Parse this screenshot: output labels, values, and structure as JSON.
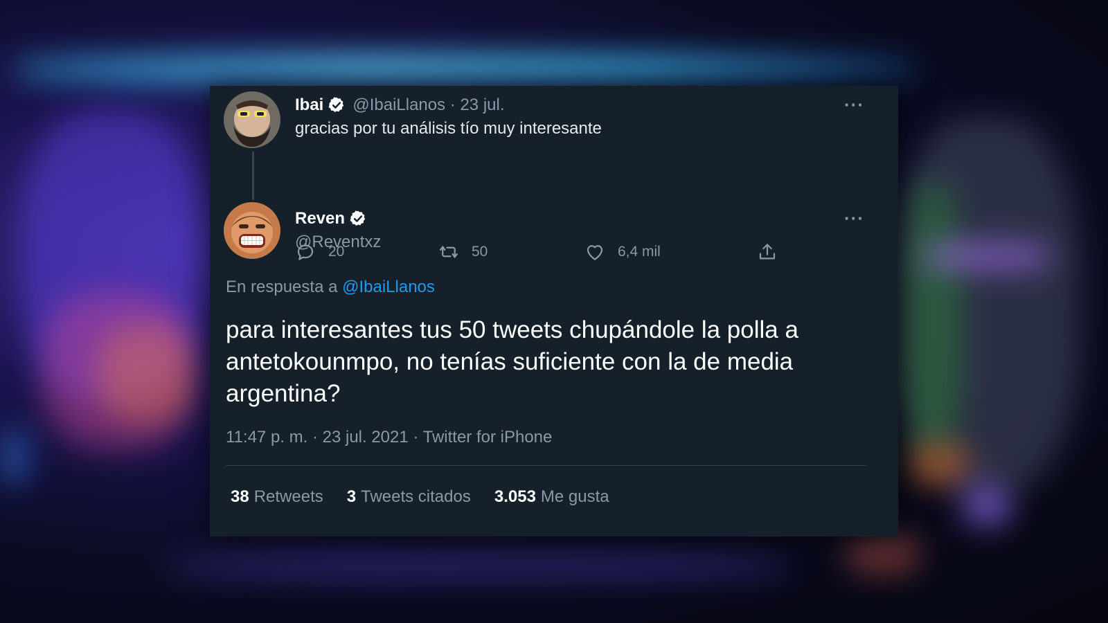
{
  "parent_tweet": {
    "author_name": "Ibai",
    "handle_date": "@IbaiLlanos · 23 jul.",
    "text": "gracias por tu análisis tío muy interesante",
    "replies": "20",
    "retweets": "50",
    "likes": "6,4 mil",
    "more_label": "···",
    "icons": [
      "verified-badge-icon",
      "reply-icon",
      "retweet-icon",
      "like-icon",
      "share-icon"
    ]
  },
  "main_tweet": {
    "author_name": "Reven",
    "handle": "@Reventxz",
    "more_label": "···",
    "reply_prefix": "En respuesta a",
    "reply_target": "@IbaiLlanos",
    "text": "para interesantes tus 50 tweets chupándole la polla a antetokounmpo, no tenías suficiente con la de media argentina?",
    "meta": "11:47 p. m. · 23 jul. 2021 · Twitter for iPhone",
    "stats": {
      "retweets_count": "38",
      "retweets_label": "Retweets",
      "quotes_count": "3",
      "quotes_label": "Tweets citados",
      "likes_count": "3.053",
      "likes_label": "Me gusta"
    }
  },
  "colors": {
    "card_bg": "#15202b",
    "text_primary": "#ffffff",
    "text_secondary": "#8b98a5",
    "link": "#1d9bf0",
    "divider": "#38444d"
  }
}
